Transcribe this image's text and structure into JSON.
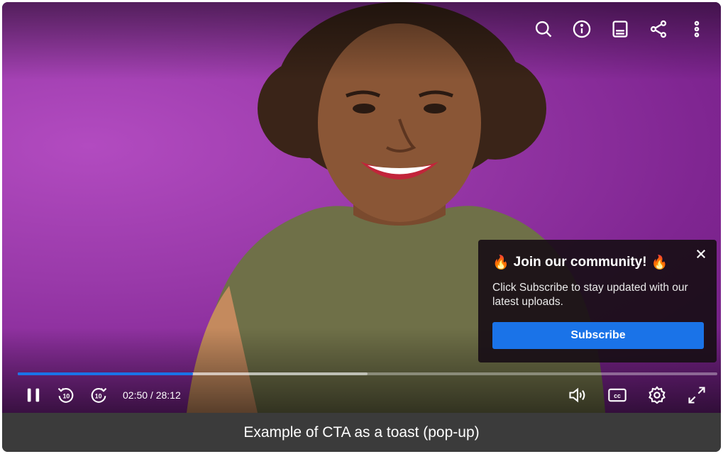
{
  "toast": {
    "emoji": "🔥",
    "title": "Join our community!",
    "body": "Click Subscribe to stay updated with our latest uploads.",
    "subscribe_label": "Subscribe"
  },
  "player": {
    "current_time": "02:50",
    "duration": "28:12",
    "time_display": "02:50 / 28:12",
    "progress_fraction": 0.25,
    "buffer_fraction": 0.5,
    "skip_seconds": "10"
  },
  "caption": "Example of CTA as a toast (pop-up)",
  "colors": {
    "accent": "#1a73e8",
    "background": "#8e2fa3"
  },
  "icons": {
    "top": [
      "search-icon",
      "info-icon",
      "transcript-icon",
      "share-icon",
      "more-options-icon"
    ],
    "bottom_left": [
      "pause-icon",
      "rewind-10-icon",
      "forward-10-icon"
    ],
    "bottom_right": [
      "volume-icon",
      "closed-captions-icon",
      "settings-icon",
      "fullscreen-icon"
    ]
  }
}
